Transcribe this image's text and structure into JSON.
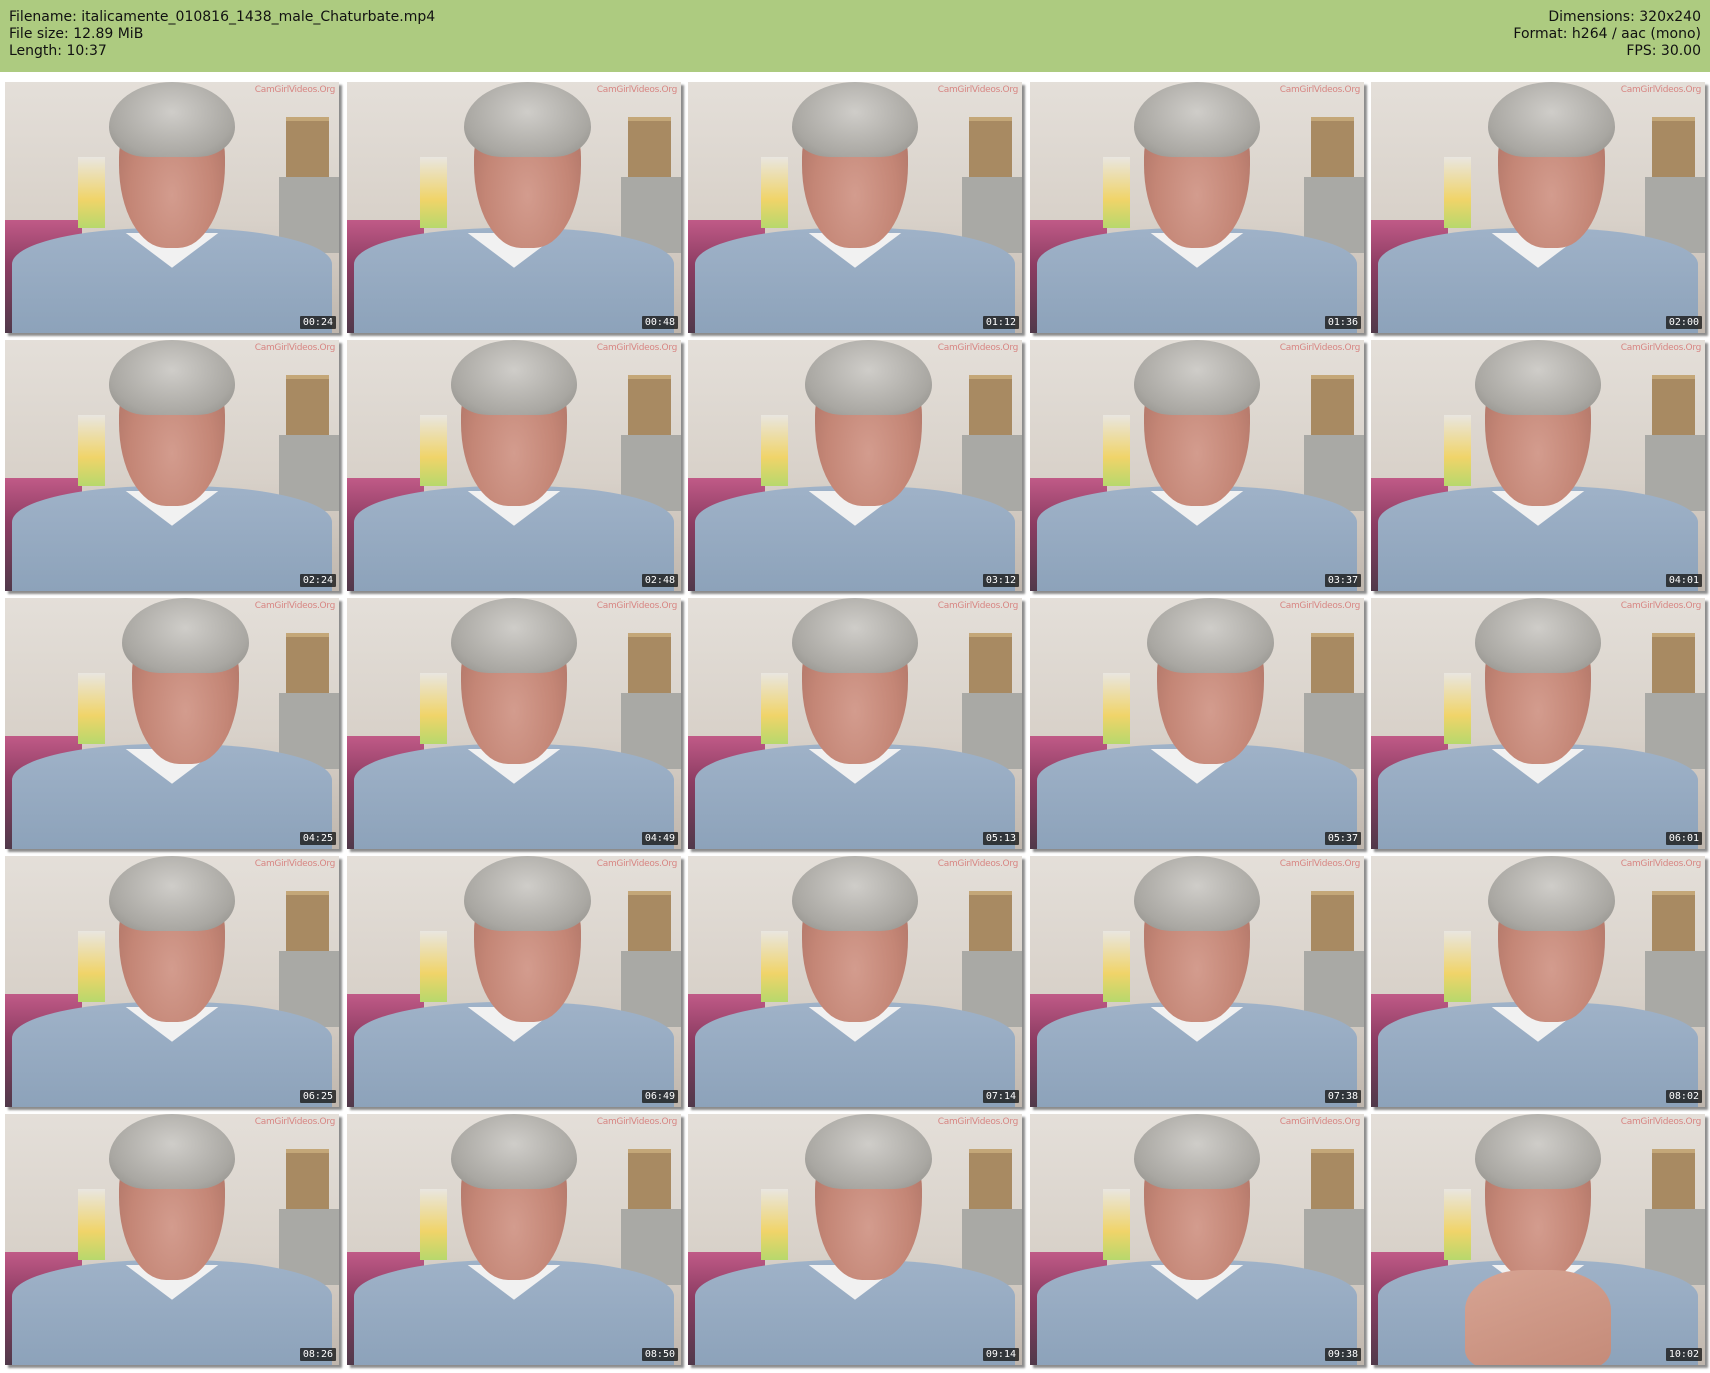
{
  "header": {
    "filename": "Filename: italicamente_010816_1438_male_Chaturbate.mp4",
    "filesize": "File size: 12.89 MiB",
    "length": "Length: 10:37",
    "dimensions": "Dimensions: 320x240",
    "format": "Format: h264 / aac (mono)",
    "fps": "FPS: 30.00"
  },
  "watermark": "CamGirlVideos.Org",
  "colors": {
    "header_bg": "#adcb80",
    "timestamp_bg": "#191919"
  },
  "thumbnails": [
    {
      "timestamp": "00:24"
    },
    {
      "timestamp": "00:48"
    },
    {
      "timestamp": "01:12"
    },
    {
      "timestamp": "01:36"
    },
    {
      "timestamp": "02:00"
    },
    {
      "timestamp": "02:24"
    },
    {
      "timestamp": "02:48"
    },
    {
      "timestamp": "03:12"
    },
    {
      "timestamp": "03:37"
    },
    {
      "timestamp": "04:01"
    },
    {
      "timestamp": "04:25"
    },
    {
      "timestamp": "04:49"
    },
    {
      "timestamp": "05:13"
    },
    {
      "timestamp": "05:37"
    },
    {
      "timestamp": "06:01"
    },
    {
      "timestamp": "06:25"
    },
    {
      "timestamp": "06:49"
    },
    {
      "timestamp": "07:14"
    },
    {
      "timestamp": "07:38"
    },
    {
      "timestamp": "08:02"
    },
    {
      "timestamp": "08:26"
    },
    {
      "timestamp": "08:50"
    },
    {
      "timestamp": "09:14"
    },
    {
      "timestamp": "09:38"
    },
    {
      "timestamp": "10:02"
    }
  ]
}
